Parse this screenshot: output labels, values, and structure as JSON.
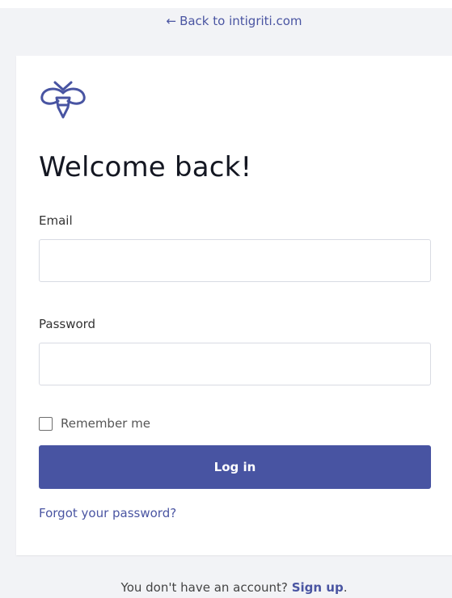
{
  "header": {
    "back_arrow": "←",
    "back_label": "Back to intigriti.com"
  },
  "card": {
    "logo_icon": "intigriti-bee-logo",
    "title": "Welcome back!",
    "email": {
      "label": "Email",
      "value": "",
      "placeholder": ""
    },
    "password": {
      "label": "Password",
      "value": "",
      "placeholder": ""
    },
    "remember": {
      "label": "Remember me",
      "checked": false
    },
    "login_label": "Log in",
    "forgot_label": "Forgot your password?"
  },
  "footer": {
    "prompt": "You don't have an account?",
    "signup_label": "Sign up",
    "period": "."
  },
  "colors": {
    "accent": "#4854a2",
    "background": "#f2f3f6",
    "card": "#ffffff",
    "title": "#141722"
  }
}
